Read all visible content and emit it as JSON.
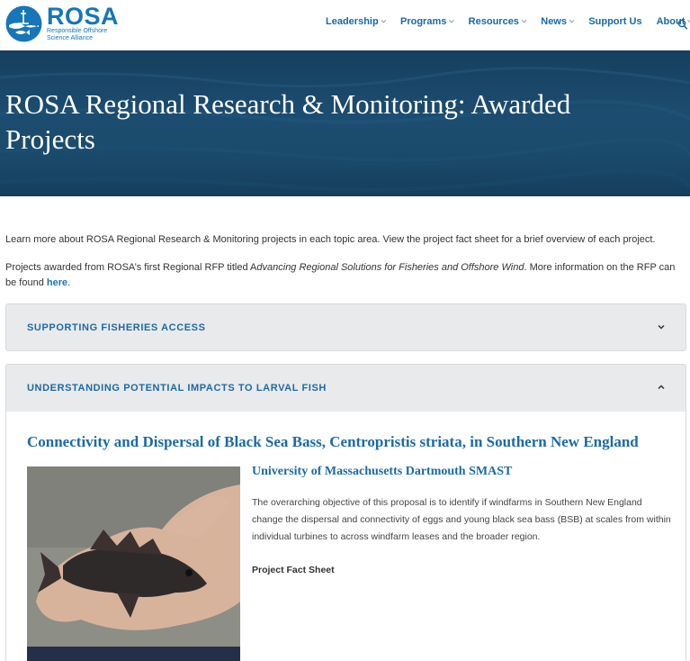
{
  "header": {
    "logo_word": "ROSA",
    "logo_sub_1": "Responsible Offshore",
    "logo_sub_2": "Science Alliance",
    "nav": [
      {
        "label": "Leadership",
        "has_menu": true
      },
      {
        "label": "Programs",
        "has_menu": true
      },
      {
        "label": "Resources",
        "has_menu": true
      },
      {
        "label": "News",
        "has_menu": true
      },
      {
        "label": "Support Us",
        "has_menu": false
      },
      {
        "label": "About",
        "has_menu": true
      }
    ],
    "search_icon": "search-icon"
  },
  "hero": {
    "title": "ROSA Regional Research & Monitoring: Awarded Projects"
  },
  "content": {
    "intro": "Learn more about ROSA Regional Research & Monitoring projects in each topic area. View the project fact sheet for a brief overview of each project.",
    "rfp_pre": "Projects awarded from ROSA’s first Regional RFP titled A",
    "rfp_em": "dvancing Regional Solutions for Fisheries and Offshore Wind",
    "rfp_post": ". More information on the RFP can be found ",
    "rfp_link": "here",
    "rfp_end": "."
  },
  "accordions": [
    {
      "title": "SUPPORTING FISHERIES ACCESS",
      "expanded": false
    },
    {
      "title": "UNDERSTANDING POTENTIAL IMPACTS TO LARVAL FISH",
      "expanded": true
    }
  ],
  "project": {
    "title": "Connectivity and Dispersal of Black Sea Bass, Centropristis striata, in Southern New England",
    "organization": "University of Massachusetts Dartmouth SMAST",
    "description": "The overarching objective of this proposal is  to identify if windfarms in Southern New England change  the dispersal and connectivity of eggs and young black sea bass (BSB)  at  scales from within individual turbines to across windfarm leases and the broader region.",
    "fact_sheet": "Project Fact Sheet"
  },
  "colors": {
    "brand_blue": "#1676b8",
    "hero_navy": "#1c4d70",
    "accordion_bg": "#e9eaeb"
  }
}
